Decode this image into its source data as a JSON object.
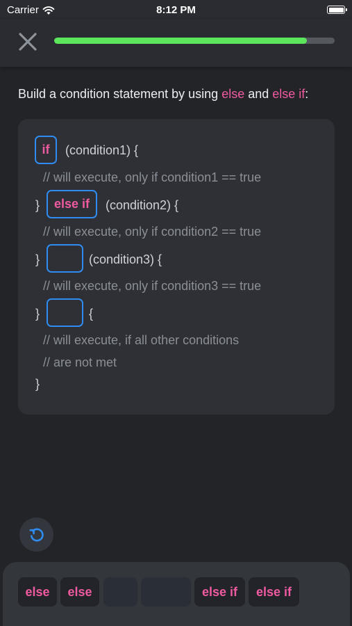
{
  "status_bar": {
    "carrier": "Carrier",
    "time": "8:12 PM"
  },
  "progress": {
    "value": 0.9
  },
  "question": {
    "prefix": "Build a condition statement by using ",
    "kw1": "else",
    "middle": " and ",
    "kw2": "else if",
    "suffix": ":"
  },
  "code": {
    "slot1": "if",
    "line1": "(condition1) {",
    "comment1": "// will execute, only if condition1 == true",
    "brace2": "}",
    "slot2": "else if",
    "line2": "(condition2) {",
    "comment2": "// will execute, only if condition2 == true",
    "brace3": "}",
    "slot3": "",
    "line3": "(condition3)  {",
    "comment3": "// will execute, only if condition3 == true",
    "brace4": "}",
    "slot4": "",
    "line4": "{",
    "comment4a": "// will execute, if all other conditions",
    "comment4b": "// are not met",
    "closing": "}"
  },
  "options": [
    "else",
    "else",
    "",
    "",
    "else if",
    "else if"
  ],
  "colors": {
    "keyword": "#f05aa0",
    "slot_border": "#2f8cf0",
    "progress": "#5ce65c",
    "background": "#222428"
  },
  "icons": {
    "close": "close-icon",
    "reset": "undo-icon",
    "wifi": "wifi-icon",
    "battery": "battery-icon"
  }
}
